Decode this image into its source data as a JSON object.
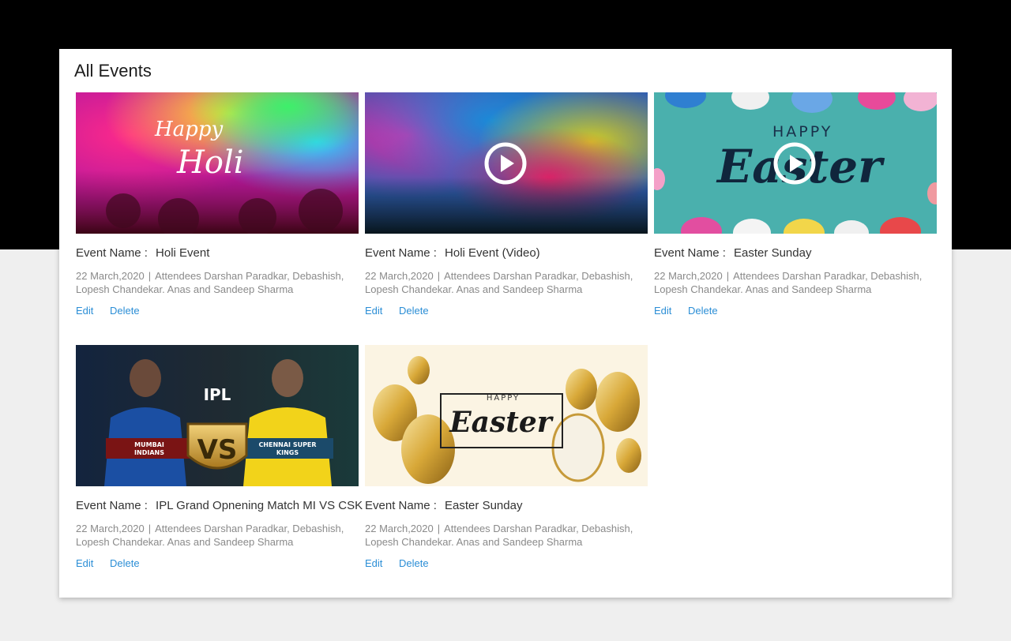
{
  "page": {
    "title": "All Events"
  },
  "labels": {
    "event_name_prefix": "Event Name :",
    "attendees_prefix": "Attendees",
    "separator": "|",
    "edit": "Edit",
    "delete": "Delete"
  },
  "events": [
    {
      "name": "Holi Event",
      "date": "22 March,2020",
      "attendees": "Darshan Paradkar, Debashish, Lopesh Chandekar. Anas and Sandeep Sharma",
      "thumbnail": {
        "type": "image",
        "icon": "holi-image",
        "overlay_text": [
          "Happy",
          "Holi"
        ]
      }
    },
    {
      "name": "Holi Event (Video)",
      "date": "22 March,2020",
      "attendees": "Darshan Paradkar, Debashish, Lopesh Chandekar. Anas and Sandeep Sharma",
      "thumbnail": {
        "type": "video",
        "icon": "play-icon"
      }
    },
    {
      "name": "Easter Sunday",
      "date": "22 March,2020",
      "attendees": "Darshan Paradkar, Debashish, Lopesh Chandekar. Anas and Sandeep Sharma",
      "thumbnail": {
        "type": "video",
        "icon": "play-icon",
        "overlay_text": [
          "HAPPY",
          "Easter"
        ]
      }
    },
    {
      "name": "IPL Grand Opnening Match MI VS CSK",
      "date": "22 March,2020",
      "attendees": "Darshan Paradkar, Debashish, Lopesh Chandekar. Anas and Sandeep Sharma",
      "thumbnail": {
        "type": "image",
        "icon": "ipl-image",
        "overlay_text": [
          "IPL",
          "VS",
          "MUMBAI INDIANS",
          "CHENNAI SUPER KINGS"
        ]
      }
    },
    {
      "name": "Easter Sunday",
      "date": "22 March,2020",
      "attendees": "Darshan Paradkar, Debashish, Lopesh Chandekar. Anas and Sandeep Sharma",
      "thumbnail": {
        "type": "image",
        "icon": "easter-eggs-image",
        "overlay_text": [
          "HAPPY",
          "Easter"
        ]
      }
    }
  ],
  "colors": {
    "top_band": "#000000",
    "page_bg": "#efefef",
    "panel_bg": "#ffffff",
    "link": "#2b8ed6",
    "meta_text": "#8a8a8a",
    "title_text": "#333333"
  }
}
